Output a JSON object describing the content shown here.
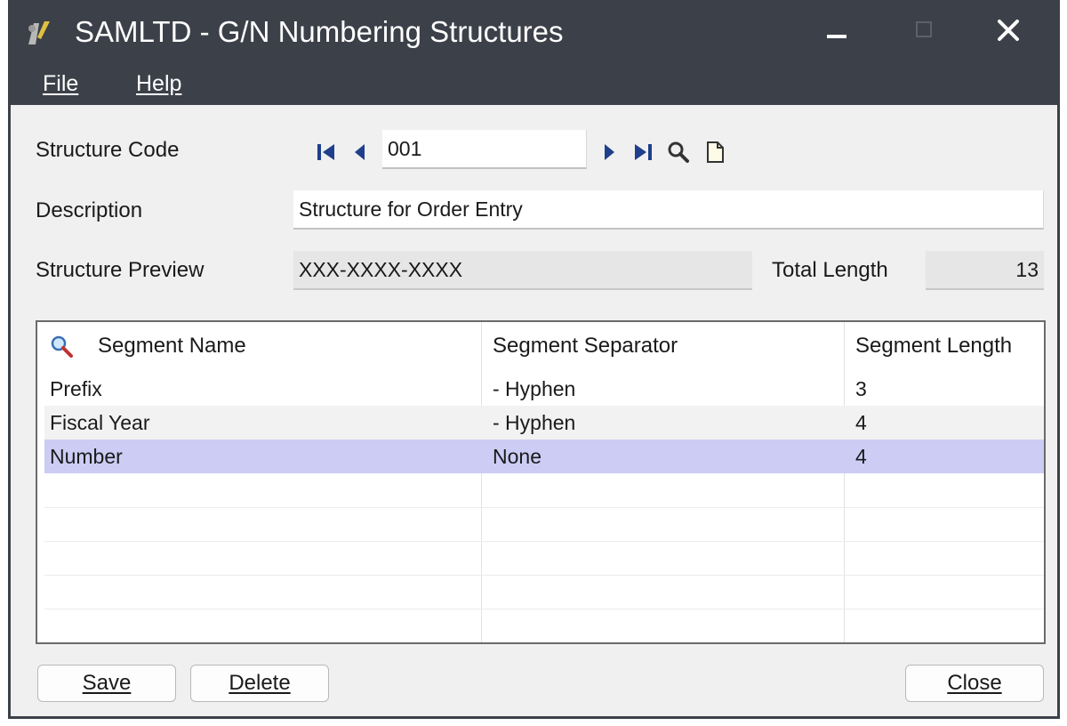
{
  "window": {
    "title": "SAMLTD - G/N Numbering Structures"
  },
  "menu": {
    "file_label": "File",
    "help_label": "Help"
  },
  "form": {
    "structure_code_label": "Structure Code",
    "structure_code_value": "001",
    "description_label": "Description",
    "description_value": "Structure for Order Entry",
    "preview_label": "Structure Preview",
    "preview_value": "XXX-XXXX-XXXX",
    "total_length_label": "Total Length",
    "total_length_value": "13"
  },
  "grid": {
    "columns": [
      "Segment Name",
      "Segment Separator",
      "Segment Length"
    ],
    "rows": [
      {
        "name": "Prefix",
        "separator": "- Hyphen",
        "length": "3"
      },
      {
        "name": "Fiscal Year",
        "separator": "- Hyphen",
        "length": "4"
      },
      {
        "name": "Number",
        "separator": "None",
        "length": "4"
      }
    ],
    "selected_row_color": "#ccccf5",
    "alt_row_color": "#f2f2f2"
  },
  "buttons": {
    "save_label": "Save",
    "delete_label": "Delete",
    "close_label": "Close"
  },
  "icons": {
    "first": "first-record-icon",
    "prev": "previous-record-icon",
    "next": "next-record-icon",
    "last": "last-record-icon",
    "finder": "finder-icon",
    "new": "new-document-icon",
    "grid_search": "grid-search-icon"
  },
  "colors": {
    "titlebar": "#3c4049",
    "nav_icon": "#1f3f8c"
  }
}
